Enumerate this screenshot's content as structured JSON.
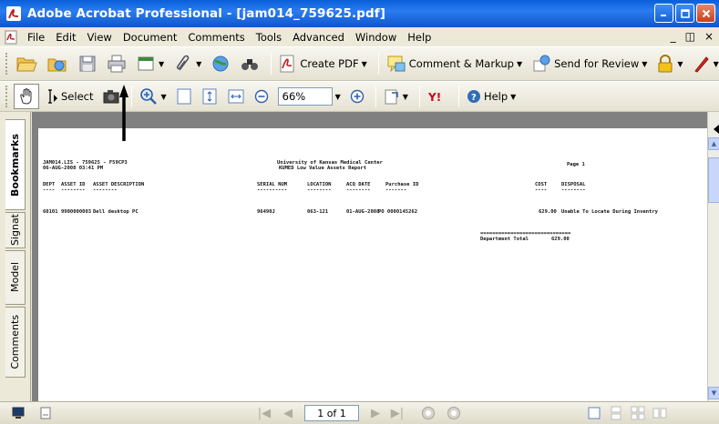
{
  "window": {
    "title": "Adobe Acrobat Professional - [jam014_759625.pdf]",
    "buttons": [
      "minimize",
      "maximize",
      "close"
    ]
  },
  "menu": {
    "items": [
      "File",
      "Edit",
      "View",
      "Document",
      "Comments",
      "Tools",
      "Advanced",
      "Window",
      "Help"
    ],
    "right": [
      "_",
      "×"
    ]
  },
  "toolbar1": {
    "create_pdf": "Create PDF",
    "comment_markup": "Comment & Markup",
    "send_review": "Send for Review"
  },
  "toolbar2": {
    "select": "Select",
    "zoom": "66%",
    "help": "Help"
  },
  "sidetabs": [
    "Bookmarks",
    "Signat",
    "Model",
    "Comments"
  ],
  "report": {
    "header_left_1": "JAM014.LIS - 759625 - F59CP3",
    "header_left_2": "06-AUG-2008 03:41 PM",
    "title_1": "University of Kansas Medical Center",
    "title_2": "KUMED Low Value Assets Report",
    "page": "Page 1",
    "columns": [
      "DEPT",
      "ASSET ID",
      "ASSET DESCRIPTION",
      "SERIAL NUM",
      "LOCATION",
      "ACQ DATE",
      "Purchase ID",
      "COST",
      "DISPOSAL"
    ],
    "dashes": [
      "----",
      "--------",
      "--------",
      "----------",
      "--------",
      "--------",
      "-------",
      "----",
      "--------"
    ],
    "row": {
      "dept": "60101",
      "asset_id": "9900000003",
      "description": "Dell desktop PC",
      "serial": "96490J",
      "location": "063-121",
      "acq_date": "01-AUG-2008",
      "purchase_id": "PO 0000145262",
      "cost": "629.00",
      "disposal": "Unable To Locate During Inventry"
    },
    "total_line": "==============================",
    "total_label": "Department Total",
    "total_value": "629.00"
  },
  "statusbar": {
    "page_indicator": "1 of 1"
  }
}
